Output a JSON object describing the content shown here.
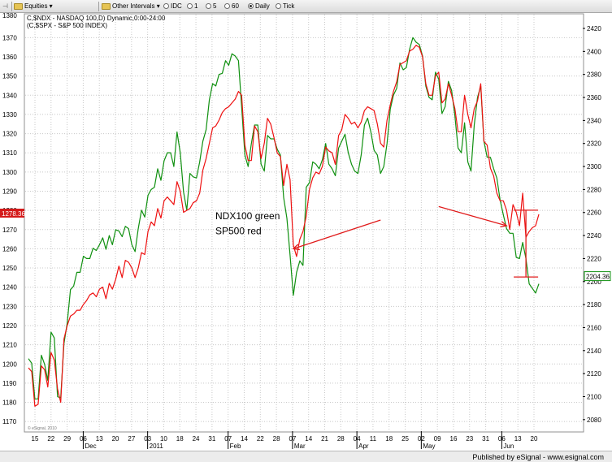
{
  "toolbar": {
    "items": [
      {
        "label": "Equities ▾",
        "icon": "folder-icon"
      },
      {
        "label": "Other Intervals ▾",
        "icon": "folder-icon"
      },
      {
        "label": "IDC",
        "icon": "radio-icon",
        "selected": false
      },
      {
        "label": "1",
        "icon": "radio-icon",
        "selected": false
      },
      {
        "label": "5",
        "icon": "radio-icon",
        "selected": false
      },
      {
        "label": "60",
        "icon": "radio-icon",
        "selected": false
      },
      {
        "label": "Daily",
        "icon": "radio-icon",
        "selected": true
      },
      {
        "label": "Tick",
        "icon": "radio-icon",
        "selected": false
      }
    ]
  },
  "footer": {
    "text": "Published by eSignal - www.esignal.com"
  },
  "colors": {
    "ndx": "#109010",
    "spx": "#ee1111",
    "flag_bg": "#d41a1a"
  },
  "chart_data": {
    "type": "line",
    "title": "C,$NDX - NASDAQ 100,D) Dynamic,0:00-24:00",
    "subtitle": "(C,$SPX - S&P 500 INDEX)",
    "watermark": "© eSignal, 2010",
    "left_axis": {
      "ylim": [
        1165,
        1382
      ],
      "ticks": [
        1170,
        1180,
        1190,
        1200,
        1210,
        1220,
        1230,
        1240,
        1250,
        1260,
        1270,
        1280,
        1290,
        1300,
        1310,
        1320,
        1330,
        1340,
        1350,
        1360,
        1370
      ],
      "top_label": "1380",
      "last_value_label": "1278.36",
      "last_value": 1278.36
    },
    "right_axis": {
      "ylim": [
        2070,
        2432
      ],
      "ticks": [
        2080,
        2100,
        2120,
        2140,
        2160,
        2180,
        2200,
        2220,
        2240,
        2260,
        2280,
        2300,
        2320,
        2340,
        2360,
        2380,
        2400,
        2420
      ],
      "last_value_label": "2204.36",
      "last_value": 2204.36
    },
    "x_ticks": [
      {
        "label": "15"
      },
      {
        "label": "22"
      },
      {
        "label": "29"
      },
      {
        "label": "06"
      },
      {
        "label": "13"
      },
      {
        "label": "20"
      },
      {
        "label": "27"
      },
      {
        "label": "03"
      },
      {
        "label": "10"
      },
      {
        "label": "18"
      },
      {
        "label": "24"
      },
      {
        "label": "31"
      },
      {
        "label": "07"
      },
      {
        "label": "14"
      },
      {
        "label": "22"
      },
      {
        "label": "28"
      },
      {
        "label": "07"
      },
      {
        "label": "14"
      },
      {
        "label": "21"
      },
      {
        "label": "28"
      },
      {
        "label": "04"
      },
      {
        "label": "11"
      },
      {
        "label": "18"
      },
      {
        "label": "25"
      },
      {
        "label": "02"
      },
      {
        "label": "09"
      },
      {
        "label": "16"
      },
      {
        "label": "23"
      },
      {
        "label": "31"
      },
      {
        "label": "06"
      },
      {
        "label": "13"
      },
      {
        "label": "20"
      }
    ],
    "month_labels": [
      {
        "label": "Dec",
        "tick_index": 3
      },
      {
        "label": "2011",
        "tick_index": 7
      },
      {
        "label": "Feb",
        "tick_index": 12
      },
      {
        "label": "Mar",
        "tick_index": 16
      },
      {
        "label": "Apr",
        "tick_index": 20
      },
      {
        "label": "May",
        "tick_index": 24
      },
      {
        "label": "Jun",
        "tick_index": 29
      }
    ],
    "series": [
      {
        "name": "NDX100",
        "axis": "right",
        "values": [
          2133,
          2129,
          2098,
          2098,
          2136,
          2128,
          2114,
          2156,
          2151,
          2100,
          2099,
          2146,
          2164,
          2193,
          2196,
          2208,
          2208,
          2222,
          2220,
          2220,
          2229,
          2227,
          2232,
          2238,
          2228,
          2240,
          2232,
          2245,
          2244,
          2239,
          2248,
          2246,
          2232,
          2226,
          2246,
          2262,
          2256,
          2275,
          2280,
          2282,
          2298,
          2288,
          2305,
          2312,
          2312,
          2300,
          2330,
          2312,
          2278,
          2262,
          2294,
          2291,
          2290,
          2304,
          2322,
          2332,
          2358,
          2372,
          2370,
          2380,
          2381,
          2392,
          2388,
          2398,
          2396,
          2392,
          2352,
          2310,
          2300,
          2320,
          2336,
          2336,
          2302,
          2296,
          2327,
          2324,
          2324,
          2315,
          2310,
          2273,
          2255,
          2223,
          2188,
          2208,
          2218,
          2214,
          2282,
          2286,
          2304,
          2302,
          2298,
          2306,
          2320,
          2302,
          2298,
          2292,
          2316,
          2322,
          2328,
          2312,
          2302,
          2296,
          2294,
          2310,
          2336,
          2342,
          2330,
          2314,
          2310,
          2294,
          2300,
          2320,
          2350,
          2362,
          2368,
          2390,
          2384,
          2386,
          2402,
          2412,
          2408,
          2406,
          2396,
          2370,
          2360,
          2358,
          2382,
          2376,
          2346,
          2352,
          2374,
          2366,
          2344,
          2316,
          2312,
          2338,
          2304,
          2296,
          2336,
          2360,
          2370,
          2322,
          2308,
          2308,
          2298,
          2290,
          2271,
          2258,
          2246,
          2242,
          2242,
          2221,
          2220,
          2234,
          2220,
          2198,
          2194,
          2190,
          2198
        ]
      },
      {
        "name": "SP500",
        "axis": "left",
        "values": [
          1198,
          1196,
          1178,
          1179,
          1199,
          1197,
          1188,
          1206,
          1202,
          1187,
          1180,
          1213,
          1220,
          1225,
          1226,
          1228,
          1228,
          1231,
          1233,
          1236,
          1237,
          1235,
          1239,
          1240,
          1234,
          1242,
          1239,
          1244,
          1251,
          1245,
          1254,
          1253,
          1250,
          1245,
          1250,
          1258,
          1257,
          1269,
          1274,
          1272,
          1281,
          1276,
          1285,
          1287,
          1285,
          1283,
          1295,
          1290,
          1279,
          1280,
          1281,
          1284,
          1285,
          1289,
          1301,
          1307,
          1315,
          1323,
          1324,
          1327,
          1331,
          1333,
          1334,
          1336,
          1338,
          1342,
          1340,
          1314,
          1306,
          1306,
          1324,
          1321,
          1307,
          1315,
          1328,
          1325,
          1318,
          1310,
          1308,
          1293,
          1304,
          1296,
          1262,
          1256,
          1265,
          1269,
          1277,
          1291,
          1297,
          1300,
          1299,
          1303,
          1313,
          1311,
          1310,
          1304,
          1319,
          1322,
          1330,
          1328,
          1325,
          1326,
          1323,
          1326,
          1332,
          1334,
          1333,
          1332,
          1325,
          1315,
          1313,
          1327,
          1335,
          1342,
          1347,
          1356,
          1357,
          1358,
          1363,
          1364,
          1366,
          1365,
          1360,
          1346,
          1340,
          1340,
          1350,
          1352,
          1336,
          1338,
          1346,
          1340,
          1333,
          1321,
          1321,
          1340,
          1330,
          1323,
          1333,
          1337,
          1346,
          1316,
          1314,
          1302,
          1298,
          1289,
          1285,
          1285,
          1280,
          1270,
          1283,
          1279,
          1272,
          1289,
          1266,
          1269,
          1271,
          1272,
          1278
        ]
      }
    ],
    "annotations": [
      {
        "text": "NDX100 green",
        "value": 1275.5
      },
      {
        "text": "SP500 red",
        "value": 1267.5
      }
    ],
    "arrows": [
      {
        "from_index": 109,
        "from_value": 1275,
        "to_index": 82,
        "to_value": 1260
      },
      {
        "from_index": 127,
        "from_value": 1282,
        "to_index": 148,
        "to_value": 1272
      }
    ],
    "range_marker": {
      "index": 154,
      "from_value": 2262,
      "to_value": 2204
    }
  }
}
